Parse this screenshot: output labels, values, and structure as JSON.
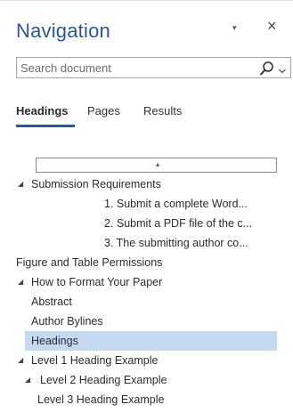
{
  "pane": {
    "title": "Navigation",
    "menu_glyph": "▾",
    "close_glyph": "×"
  },
  "search": {
    "placeholder": "Search document",
    "value": ""
  },
  "tabs": [
    {
      "label": "Headings",
      "active": true
    },
    {
      "label": "Pages",
      "active": false
    },
    {
      "label": "Results",
      "active": false
    }
  ],
  "collapse_glyph": "▴",
  "tree": [
    {
      "label": "Submission Requirements",
      "level": 1,
      "expanded": true,
      "selected": false
    },
    {
      "label": "1. Submit a complete Word...",
      "level": 3,
      "expanded": null,
      "selected": false
    },
    {
      "label": "2. Submit a PDF file of the c...",
      "level": 3,
      "expanded": null,
      "selected": false
    },
    {
      "label": "3. The submitting author co...",
      "level": 3,
      "expanded": null,
      "selected": false
    },
    {
      "label": "Figure and Table Permissions",
      "level": 0,
      "expanded": null,
      "selected": false
    },
    {
      "label": "How to Format Your Paper",
      "level": 1,
      "expanded": true,
      "selected": false
    },
    {
      "label": "Abstract",
      "level": 2,
      "expanded": null,
      "selected": false
    },
    {
      "label": "Author Bylines",
      "level": 2,
      "expanded": null,
      "selected": false
    },
    {
      "label": "Headings",
      "level": 2,
      "expanded": null,
      "selected": true
    },
    {
      "label": "Level 1 Heading Example",
      "level": 1,
      "expanded": true,
      "selected": false
    },
    {
      "label": "Level 2 Heading Example",
      "level": 2,
      "expanded": true,
      "selected": false
    },
    {
      "label": "Level 3 Heading Example",
      "level": 4,
      "expanded": null,
      "selected": false
    }
  ],
  "colors": {
    "accent": "#2b579a",
    "selection": "#c5d9f1"
  },
  "icons": {
    "search": "magnifier-icon",
    "search_dropdown": "chevron-down-icon",
    "pane_menu": "chevron-down-icon",
    "close": "close-icon",
    "expanded_node": "triangle-expanded-icon"
  }
}
